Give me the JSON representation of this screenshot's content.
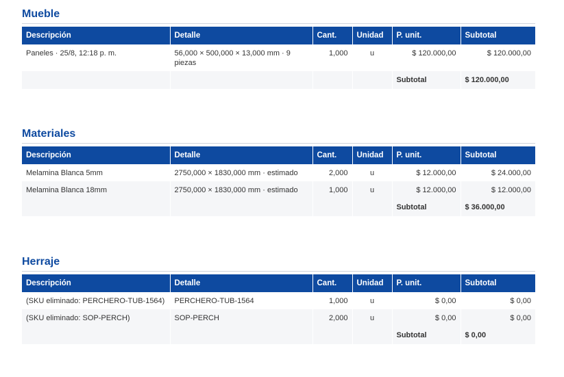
{
  "headers": {
    "descripcion": "Descripción",
    "detalle": "Detalle",
    "cant": "Cant.",
    "unidad": "Unidad",
    "p_unit": "P. unit.",
    "subtotal": "Subtotal"
  },
  "sections": [
    {
      "title": "Mueble",
      "rows": [
        {
          "descripcion": "Paneles · 25/8, 12:18 p. m.",
          "detalle": "56,000 × 500,000 × 13,000 mm · 9 piezas",
          "cant": "1,000",
          "unidad": "u",
          "p_unit": "$ 120.000,00",
          "subtotal": "$ 120.000,00"
        }
      ],
      "total_label": "Subtotal",
      "total_value": "$ 120.000,00"
    },
    {
      "title": "Materiales",
      "rows": [
        {
          "descripcion": "Melamina Blanca 5mm",
          "detalle": "2750,000 × 1830,000 mm · estimado",
          "cant": "2,000",
          "unidad": "u",
          "p_unit": "$ 12.000,00",
          "subtotal": "$ 24.000,00"
        },
        {
          "descripcion": "Melamina Blanca 18mm",
          "detalle": "2750,000 × 1830,000 mm · estimado",
          "cant": "1,000",
          "unidad": "u",
          "p_unit": "$ 12.000,00",
          "subtotal": "$ 12.000,00"
        }
      ],
      "total_label": "Subtotal",
      "total_value": "$ 36.000,00"
    },
    {
      "title": "Herraje",
      "rows": [
        {
          "descripcion": "(SKU eliminado: PERCHERO-TUB-1564)",
          "detalle": "PERCHERO-TUB-1564",
          "cant": "1,000",
          "unidad": "u",
          "p_unit": "$ 0,00",
          "subtotal": "$ 0,00"
        },
        {
          "descripcion": "(SKU eliminado: SOP-PERCH)",
          "detalle": "SOP-PERCH",
          "cant": "2,000",
          "unidad": "u",
          "p_unit": "$ 0,00",
          "subtotal": "$ 0,00"
        }
      ],
      "total_label": "Subtotal",
      "total_value": "$ 0,00"
    }
  ],
  "colors": {
    "header_bg": "#0e4aa0",
    "title": "#0e4aa0",
    "stripe": "#f5f6f8"
  }
}
